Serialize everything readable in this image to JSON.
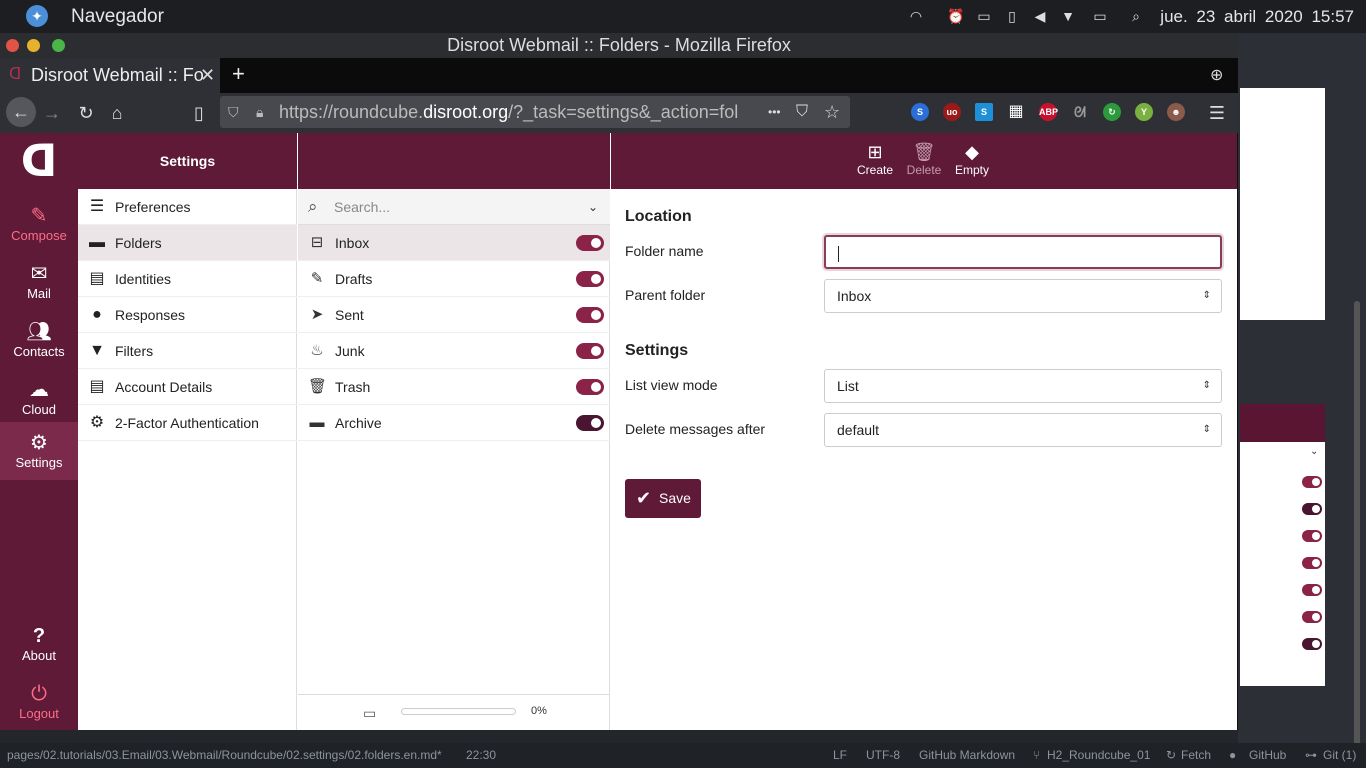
{
  "system_panel": {
    "app_name": "Navegador",
    "clock": "jue. 23 abril 2020  15:57"
  },
  "window": {
    "title": "Disroot Webmail :: Folders - Mozilla Firefox"
  },
  "browser": {
    "tab_title": "Disroot Webmail :: Fo",
    "url_pre": "https://roundcube.",
    "url_domain": "disroot.org",
    "url_post": "/?_task=settings&_action=fol",
    "menu_dots": "•••"
  },
  "sidebar": {
    "items": [
      {
        "label": "Compose"
      },
      {
        "label": "Mail"
      },
      {
        "label": "Contacts"
      },
      {
        "label": "Cloud"
      },
      {
        "label": "Settings"
      }
    ],
    "bottom": [
      {
        "label": "About"
      },
      {
        "label": "Logout"
      }
    ]
  },
  "settings_panel": {
    "title": "Settings",
    "items": [
      {
        "label": "Preferences"
      },
      {
        "label": "Folders"
      },
      {
        "label": "Identities"
      },
      {
        "label": "Responses"
      },
      {
        "label": "Filters"
      },
      {
        "label": "Account Details"
      },
      {
        "label": "2-Factor Authentication"
      }
    ]
  },
  "folders": {
    "search_placeholder": "Search...",
    "items": [
      {
        "label": "Inbox",
        "subscribed": true
      },
      {
        "label": "Drafts",
        "subscribed": true
      },
      {
        "label": "Sent",
        "subscribed": true
      },
      {
        "label": "Junk",
        "subscribed": true
      },
      {
        "label": "Trash",
        "subscribed": true
      },
      {
        "label": "Archive",
        "subscribed": true
      }
    ],
    "quota_text": "0%",
    "quota_fraction": 0
  },
  "toolbar": {
    "create": "Create",
    "delete": "Delete",
    "empty": "Empty"
  },
  "form": {
    "location_heading": "Location",
    "folder_name_label": "Folder name",
    "folder_name_value": "",
    "parent_folder_label": "Parent folder",
    "parent_folder_value": "Inbox",
    "settings_heading": "Settings",
    "list_view_label": "List view mode",
    "list_view_value": "List",
    "delete_after_label": "Delete messages after",
    "delete_after_value": "default",
    "save": "Save"
  },
  "statusbar": {
    "path": "pages/02.tutorials/03.Email/03.Webmail/Roundcube/02.settings/02.folders.en.md*",
    "cursor": "22:30",
    "eol": "LF",
    "encoding": "UTF-8",
    "grammar": "GitHub Markdown",
    "branch": "H2_Roundcube_01",
    "fetch": "Fetch",
    "github": "GitHub",
    "git": "Git (1)"
  },
  "colors": {
    "brand": "#5e1a36",
    "toggle_on": "#8a2347",
    "toggle_dark": "#4a1530"
  }
}
